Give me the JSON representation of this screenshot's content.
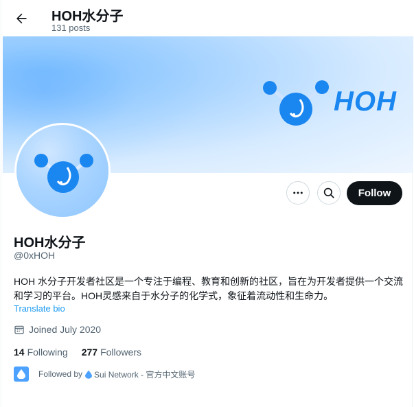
{
  "header": {
    "title": "HOH水分子",
    "posts": "131 posts"
  },
  "banner": {
    "logo_text": "HOH"
  },
  "actions": {
    "follow_label": "Follow"
  },
  "profile": {
    "display_name": "HOH水分子",
    "handle": "@0xHOH",
    "bio": "HOH 水分子开发者社区是一个专注于编程、教育和创新的社区，旨在为开发者提供一个交流和学习的平台。HOH灵感来自于水分子的化学式，象征着流动性和生命力。",
    "translate_label": "Translate bio",
    "joined": "Joined July 2020"
  },
  "stats": {
    "following_count": "14",
    "following_label": "Following",
    "followers_count": "277",
    "followers_label": "Followers"
  },
  "followed_by": {
    "prefix": "Followed by",
    "account": "Sui Network - 官方中文账号"
  },
  "colors": {
    "accent": "#1d9bf0",
    "follow_bg": "#0f1419",
    "brand_blue": "#1a86f0"
  }
}
